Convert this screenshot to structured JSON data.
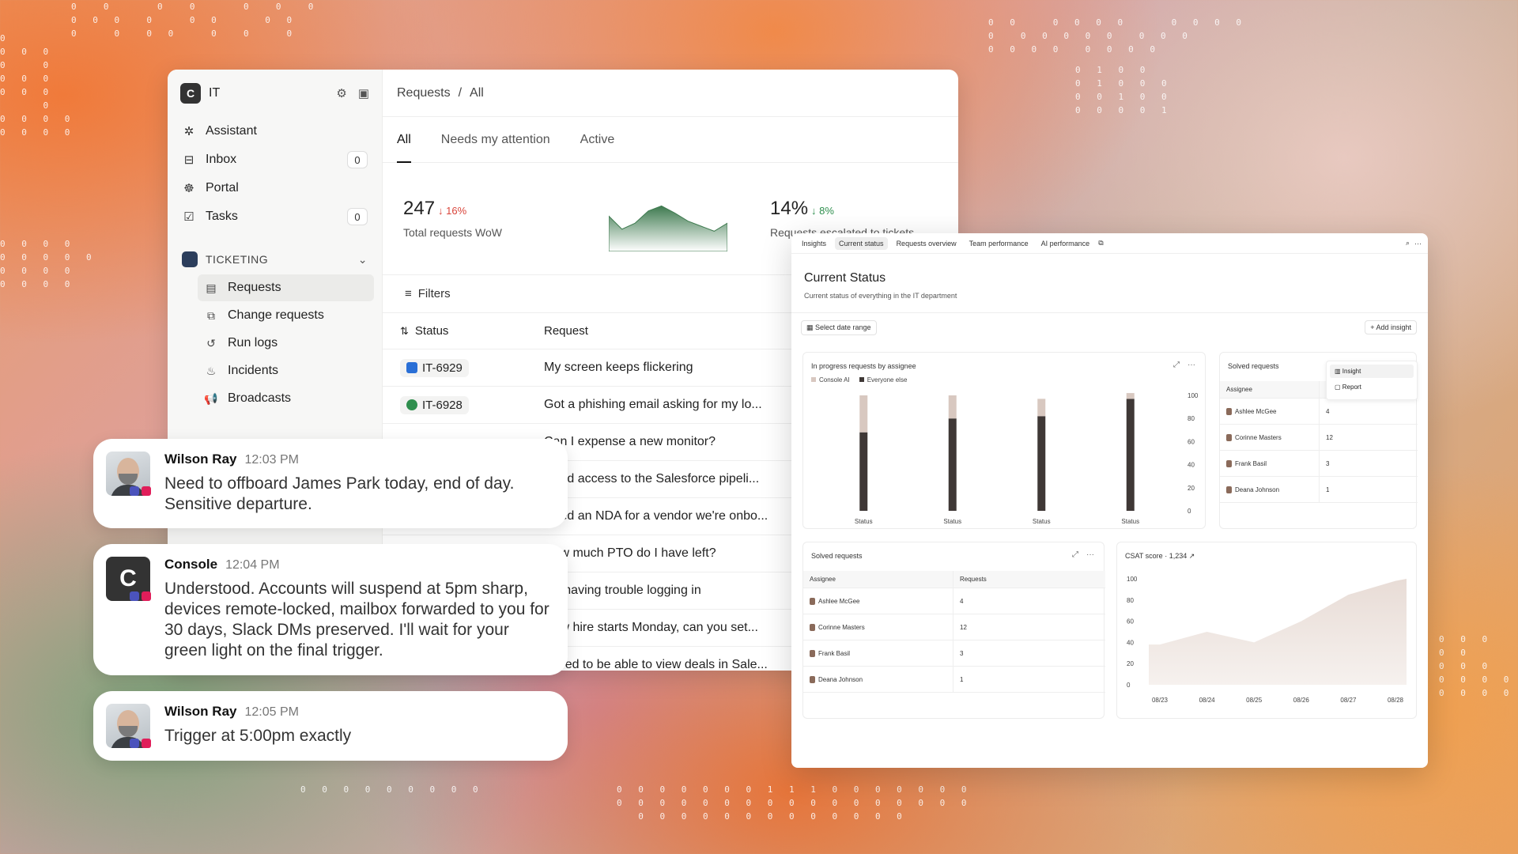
{
  "it_window": {
    "workspace": "IT",
    "logo": "C",
    "icons": [
      "gear-icon",
      "sidebar-toggle-icon"
    ],
    "nav": [
      {
        "label": "Assistant",
        "icon": "assistant-icon"
      },
      {
        "label": "Inbox",
        "icon": "inbox-icon",
        "count": "0"
      },
      {
        "label": "Portal",
        "icon": "portal-icon"
      },
      {
        "label": "Tasks",
        "icon": "tasks-icon",
        "count": "0"
      }
    ],
    "section": "TICKETING",
    "sub_nav": [
      "Requests",
      "Change requests",
      "Run logs",
      "Incidents",
      "Broadcasts"
    ],
    "breadcrumb": {
      "root": "Requests",
      "sep": "/",
      "current": "All"
    },
    "tabs": [
      "All",
      "Needs my attention",
      "Active"
    ],
    "stats": [
      {
        "value": "247",
        "delta": "↓ 16%",
        "label": "Total requests WoW",
        "delta_color": "#d9453b"
      },
      {
        "value": "14%",
        "delta": "↓ 8%",
        "label": "Requests escalated to tickets",
        "delta_color": "#2f8f4e"
      }
    ],
    "filters_label": "Filters",
    "columns": [
      "Status",
      "Request"
    ],
    "rows": [
      {
        "id": "IT-6929",
        "status": "in-progress",
        "request": "My screen keeps flickering"
      },
      {
        "id": "IT-6928",
        "status": "resolved",
        "request": "Got a phishing email asking for my lo..."
      },
      {
        "id": "",
        "status": "",
        "request": "Can I expense a new monitor?"
      },
      {
        "id": "",
        "status": "",
        "request": "Need access to the Salesforce pipeli..."
      },
      {
        "id": "",
        "status": "",
        "request": "Need an NDA for a vendor we're onbo..."
      },
      {
        "id": "",
        "status": "",
        "request": "How much PTO do I have left?"
      },
      {
        "id": "",
        "status": "",
        "request": "I'm having trouble logging in"
      },
      {
        "id": "",
        "status": "",
        "request": "New hire starts Monday, can you set..."
      },
      {
        "id": "",
        "status": "",
        "request": "I need to be able to view deals in Sale..."
      }
    ]
  },
  "chats": [
    {
      "name": "Wilson Ray",
      "time": "12:03 PM",
      "text": "Need to offboard James Park today, end of day. Sensitive departure."
    },
    {
      "name": "Console",
      "time": "12:04 PM",
      "text": "Understood. Accounts will suspend at 5pm sharp, devices remote-locked, mailbox forwarded to you for 30 days, Slack DMs preserved. I'll wait for your green light on the final trigger."
    },
    {
      "name": "Wilson Ray",
      "time": "12:05 PM",
      "text": "Trigger at 5:00pm exactly"
    }
  ],
  "insights": {
    "tabs": [
      "Insights",
      "Current status",
      "Requests overview",
      "Team performance",
      "AI performance"
    ],
    "title": "Current Status",
    "subtitle": "Current status of everything in the IT department",
    "date_btn": "Select date range",
    "add_btn": "+ Add insight",
    "bar_card_title": "In progress requests by assignee",
    "legend": [
      "Console AI",
      "Everyone else"
    ],
    "solved_title": "Solved requests",
    "solved_title2": "Solved requests",
    "menu": [
      "Insight",
      "Report"
    ],
    "table_cols": [
      "Assignee",
      "Requests"
    ],
    "assignees": [
      {
        "name": "Ashlee McGee",
        "value": "4"
      },
      {
        "name": "Corinne Masters",
        "value": "12"
      },
      {
        "name": "Frank Basil",
        "value": "3"
      },
      {
        "name": "Deana Johnson",
        "value": "1"
      }
    ],
    "csat_title": "CSAT score",
    "csat_value": "1,234 ↗"
  },
  "chart_data": [
    {
      "type": "bar",
      "title": "In progress requests by assignee",
      "categories": [
        "Status",
        "Status",
        "Status",
        "Status"
      ],
      "series": [
        {
          "name": "Everyone else",
          "values": [
            68,
            80,
            82,
            97
          ]
        },
        {
          "name": "Console AI",
          "values": [
            32,
            20,
            15,
            5
          ]
        }
      ],
      "ylim": [
        0,
        100
      ],
      "yticks": [
        0,
        20,
        40,
        60,
        80,
        100
      ],
      "colors": {
        "Everyone else": "#3f3836",
        "Console AI": "#d8c8c0"
      }
    },
    {
      "type": "area",
      "title": "CSAT score",
      "x": [
        "08/23",
        "08/24",
        "08/25",
        "08/26",
        "08/27",
        "08/28"
      ],
      "y": [
        38,
        50,
        40,
        60,
        85,
        98
      ],
      "ylim": [
        0,
        100
      ],
      "yticks": [
        0,
        20,
        40,
        60,
        80,
        100
      ]
    },
    {
      "type": "area",
      "title": "",
      "series": [
        {
          "values": [
            35,
            22,
            28,
            40,
            45,
            38,
            30,
            25,
            20,
            28
          ]
        }
      ]
    }
  ]
}
